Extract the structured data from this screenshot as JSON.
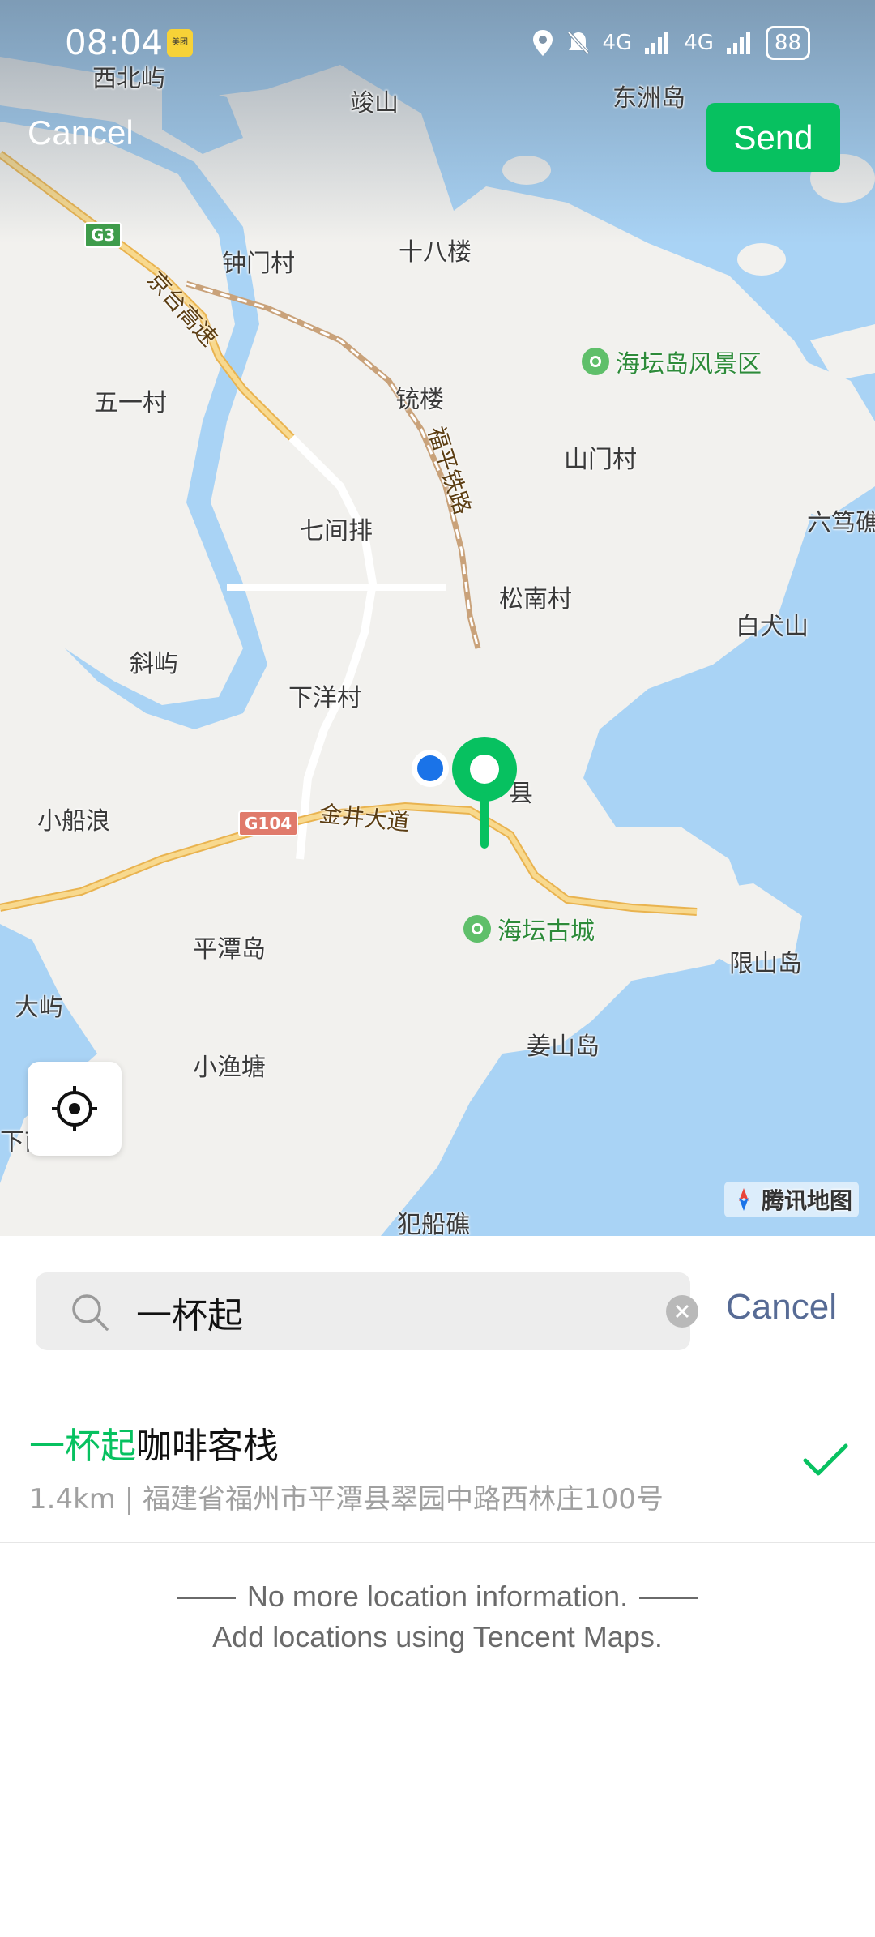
{
  "status_bar": {
    "time": "08:04",
    "app_badge": "美团",
    "network_1": "4G",
    "network_2": "4G",
    "battery": "88"
  },
  "map": {
    "cancel_label": "Cancel",
    "send_label": "Send",
    "provider": "腾讯地图",
    "places": [
      "西北屿",
      "竣山",
      "东洲岛",
      "钟门村",
      "十八楼",
      "五一村",
      "铳楼",
      "山门村",
      "六笃礁",
      "七间排",
      "松南村",
      "白犬山",
      "斜屿",
      "下洋村",
      "小船浪",
      "平潭岛",
      "限山岛",
      "大屿",
      "姜山岛",
      "小渔塘",
      "下南",
      "犯船礁",
      "县"
    ],
    "pois": [
      "海坛岛风景区",
      "海坛古城"
    ],
    "roads": [
      "京台高速",
      "福平铁路",
      "金井大道"
    ],
    "shields": [
      "G3",
      "G104"
    ]
  },
  "search": {
    "query": "一杯起",
    "cancel_label": "Cancel"
  },
  "result": {
    "title_highlight": "一杯起",
    "title_rest": "咖啡客栈",
    "address": "1.4km | 福建省福州市平潭县翠园中路西林庄100号"
  },
  "footer": {
    "line1": "No more location information.",
    "line2": "Add locations using Tencent Maps."
  },
  "colors": {
    "accent": "#07c160",
    "link": "#576b95",
    "water": "#a9d3f5",
    "land": "#f2f1ee"
  }
}
